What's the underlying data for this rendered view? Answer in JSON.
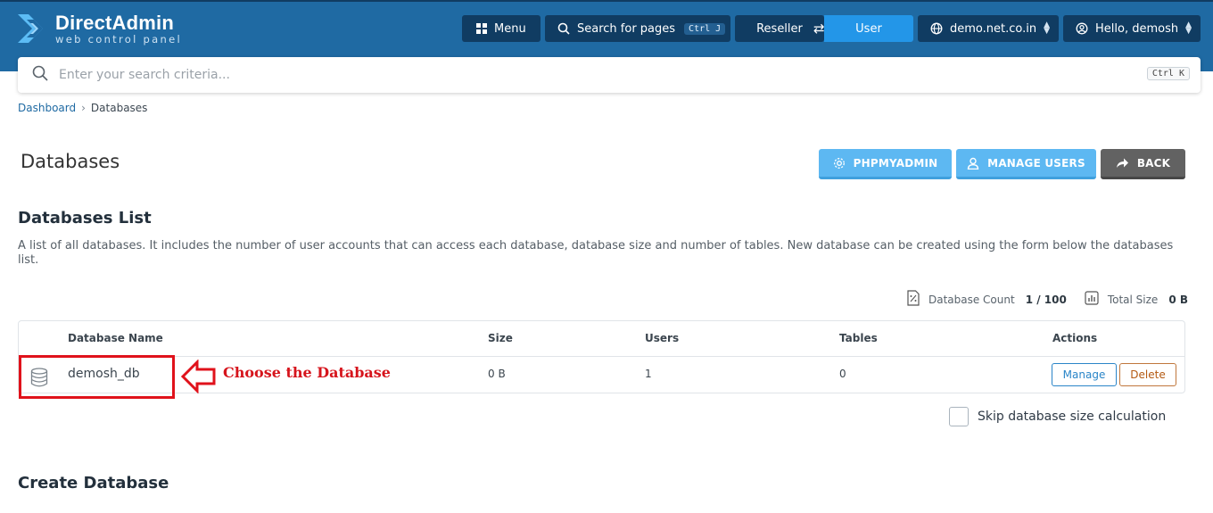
{
  "header": {
    "logo_title": "DirectAdmin",
    "logo_subtitle": "web control panel",
    "menu_label": "Menu",
    "search_label": "Search for pages",
    "search_shortcut": "Ctrl J",
    "reseller_label": "Reseller",
    "user_label": "User",
    "domain_label": "demo.net.co.in",
    "greeting_label": "Hello, demosh"
  },
  "search": {
    "placeholder": "Enter your search criteria...",
    "shortcut": "Ctrl K"
  },
  "breadcrumb": {
    "home": "Dashboard",
    "current": "Databases"
  },
  "page": {
    "title": "Databases",
    "buttons": {
      "phpmyadmin": "PHPMYADMIN",
      "manage_users": "MANAGE USERS",
      "back": "BACK"
    }
  },
  "databases_list": {
    "title": "Databases List",
    "description": "A list of all databases. It includes the number of user accounts that can access each database, database size and number of tables. New database can be created using the form below the databases list.",
    "count_label": "Database Count",
    "count_value": "1 / 100",
    "size_label": "Total Size",
    "size_value": "0 B",
    "columns": [
      "Database Name",
      "Size",
      "Users",
      "Tables",
      "Actions"
    ],
    "rows": [
      {
        "name": "demosh_db",
        "size": "0 B",
        "users": "1",
        "tables": "0",
        "manage": "Manage",
        "delete": "Delete"
      }
    ],
    "skip_label": "Skip database size calculation"
  },
  "annotation": {
    "text": "Choose the Database",
    "color": "#e0121b"
  },
  "create": {
    "title": "Create Database"
  },
  "colors": {
    "header_bg": "#1f6aa3",
    "header_btn": "#103c62",
    "accent": "#2396e8",
    "light_accent": "#5db8f2",
    "back_btn": "#626262"
  }
}
